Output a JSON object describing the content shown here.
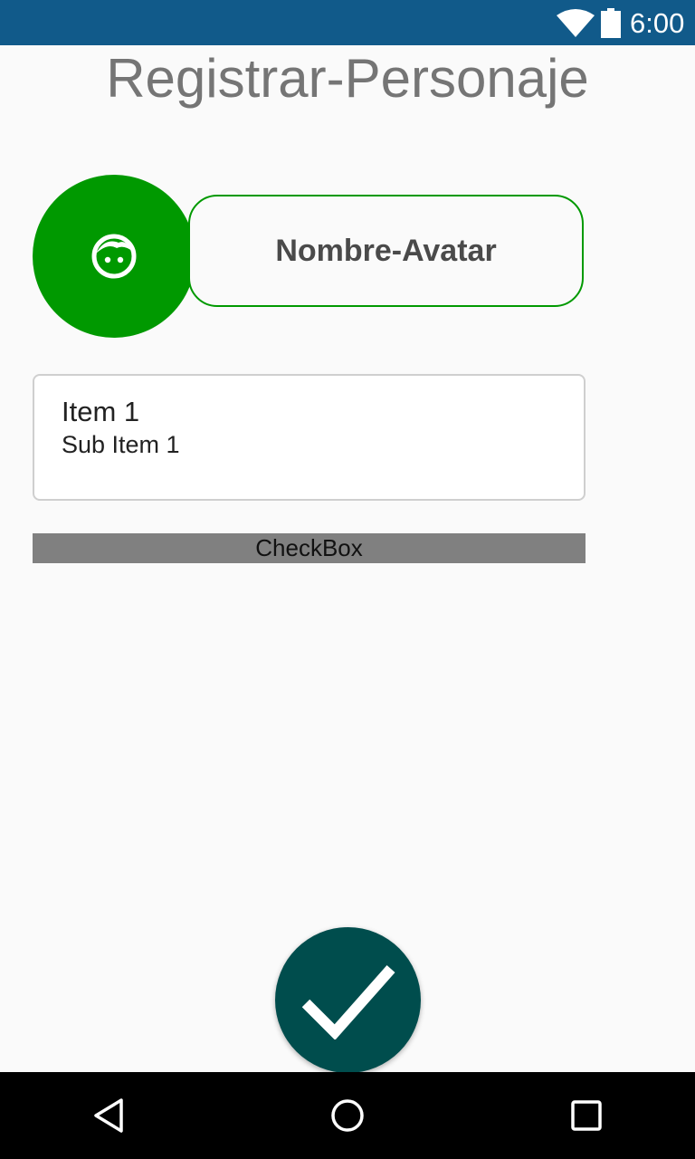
{
  "status_bar": {
    "time": "6:00",
    "icons": [
      "wifi-icon",
      "battery-icon"
    ]
  },
  "page": {
    "title": "Registrar-Personaje"
  },
  "avatar": {
    "icon": "face-icon",
    "name_label": "Nombre-Avatar"
  },
  "list": {
    "items": [
      {
        "title": "Item 1",
        "subtitle": "Sub Item 1"
      }
    ]
  },
  "checkbox": {
    "label": "CheckBox"
  },
  "fab": {
    "icon": "checkmark-icon"
  },
  "nav_bar": {
    "icons": [
      "back-icon",
      "home-icon",
      "recents-icon"
    ]
  },
  "colors": {
    "status_bar": "#115a8a",
    "accent_green": "#009900",
    "fab": "#004d4d",
    "checkbox_bg": "#808080",
    "background": "#fafafa"
  }
}
